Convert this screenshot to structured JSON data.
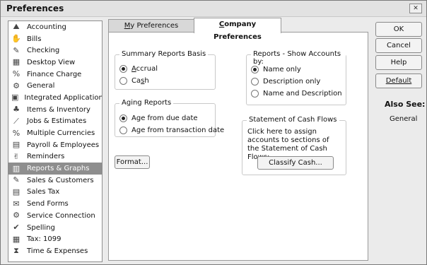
{
  "window": {
    "title": "Preferences",
    "close_glyph": "✕"
  },
  "sidebar": {
    "items": [
      {
        "label": "Accounting",
        "icon": "accounting-icon",
        "glyph": "⛰"
      },
      {
        "label": "Bills",
        "icon": "bills-icon",
        "glyph": "✋"
      },
      {
        "label": "Checking",
        "icon": "checking-icon",
        "glyph": "✎"
      },
      {
        "label": "Desktop View",
        "icon": "desktop-view-icon",
        "glyph": "▦"
      },
      {
        "label": "Finance Charge",
        "icon": "finance-charge-icon",
        "glyph": "%"
      },
      {
        "label": "General",
        "icon": "general-icon",
        "glyph": "⚙"
      },
      {
        "label": "Integrated Applications",
        "icon": "integrated-applications-icon",
        "glyph": "▣"
      },
      {
        "label": "Items & Inventory",
        "icon": "items-inventory-icon",
        "glyph": "♣"
      },
      {
        "label": "Jobs & Estimates",
        "icon": "jobs-estimates-icon",
        "glyph": "⟋"
      },
      {
        "label": "Multiple Currencies",
        "icon": "multiple-currencies-icon",
        "glyph": "%"
      },
      {
        "label": "Payroll & Employees",
        "icon": "payroll-employees-icon",
        "glyph": "▤"
      },
      {
        "label": "Reminders",
        "icon": "reminders-icon",
        "glyph": "✌"
      },
      {
        "label": "Reports & Graphs",
        "icon": "reports-graphs-icon",
        "glyph": "▥"
      },
      {
        "label": "Sales & Customers",
        "icon": "sales-customers-icon",
        "glyph": "✎"
      },
      {
        "label": "Sales Tax",
        "icon": "sales-tax-icon",
        "glyph": "▤"
      },
      {
        "label": "Send Forms",
        "icon": "send-forms-icon",
        "glyph": "✉"
      },
      {
        "label": "Service Connection",
        "icon": "service-connection-icon",
        "glyph": "⚙"
      },
      {
        "label": "Spelling",
        "icon": "spelling-icon",
        "glyph": "✔"
      },
      {
        "label": "Tax: 1099",
        "icon": "tax-1099-icon",
        "glyph": "▦"
      },
      {
        "label": "Time & Expenses",
        "icon": "time-expenses-icon",
        "glyph": "⧗"
      }
    ],
    "selected_index": 12
  },
  "tabs": {
    "my_preferences": {
      "prefix": "",
      "ul": "M",
      "rest": "y Preferences"
    },
    "company_preferences": {
      "prefix": "",
      "ul": "C",
      "rest": "ompany Preferences"
    }
  },
  "summary": {
    "title": "Summary Reports Basis",
    "options": [
      {
        "ul": "A",
        "rest": "ccrual",
        "selected": true
      },
      {
        "ul": "",
        "prefix": "Ca",
        "ul2": "s",
        "rest": "h",
        "selected": false
      }
    ]
  },
  "aging": {
    "title": "Aging Reports",
    "options": [
      {
        "label": "Age from due date",
        "selected": true
      },
      {
        "label": "Age from transaction date",
        "selected": false
      }
    ]
  },
  "format_button": "Format...",
  "show_accounts": {
    "title": "Reports - Show Accounts by:",
    "options": [
      {
        "label": "Name only",
        "selected": true
      },
      {
        "label": "Description only",
        "selected": false
      },
      {
        "label": "Name and Description",
        "selected": false
      }
    ]
  },
  "cash_flows": {
    "title": "Statement of Cash Flows",
    "text": "Click here to assign accounts to sections of the Statement of Cash Flows:",
    "button": "Classify Cash..."
  },
  "actions": {
    "ok": "OK",
    "cancel": "Cancel",
    "help": "Help",
    "default": "Default"
  },
  "also_see": {
    "title": "Also See:",
    "items": [
      "General"
    ]
  }
}
